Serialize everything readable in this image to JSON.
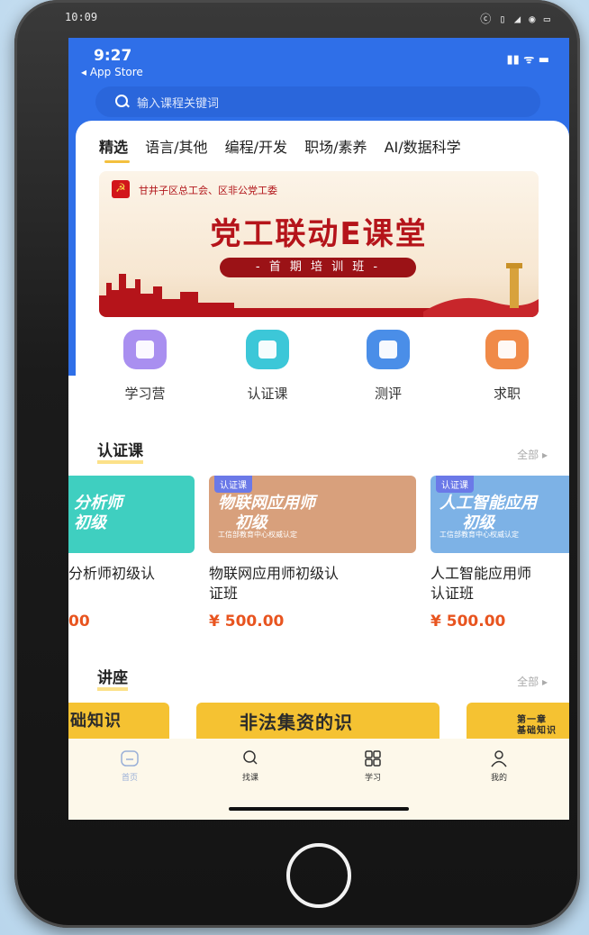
{
  "phone_status": {
    "time": "10:09",
    "icons": "ⓒ ▯ ◢ ◉ ▭"
  },
  "ios_status": {
    "time": "9:27",
    "back": "◂ App Store",
    "icons": "▮▮ ᯤ ▬"
  },
  "search": {
    "placeholder": "输入课程关键词"
  },
  "tabs": [
    "精选",
    "语言/其他",
    "编程/开发",
    "职场/素养",
    "AI/数据科学"
  ],
  "banner": {
    "org": "甘井子区总工会、区非公党工委",
    "title": "党工联动E课堂",
    "subtitle": "- 首 期 培 训 班 -"
  },
  "quick_links": [
    {
      "label": "学习营",
      "icon": "book-icon",
      "color": "#a98ff0"
    },
    {
      "label": "认证课",
      "icon": "tv-icon",
      "color": "#3cc7d8"
    },
    {
      "label": "测评",
      "icon": "clipboard-icon",
      "color": "#4a8ee8"
    },
    {
      "label": "求职",
      "icon": "briefcase-icon",
      "color": "#f08a48"
    }
  ],
  "cert_section": {
    "title": "认证课",
    "more": "全部 ▸"
  },
  "courses": [
    {
      "tag": "",
      "img_text": "分析师\n初级",
      "img_small": "工信部教育中心权威认定",
      "name": "分析师初级认",
      "name2": "",
      "price": "00",
      "color": "#3fcfc0"
    },
    {
      "tag": "认证课",
      "img_text": "物联网应用师\n初级",
      "img_small": "工信部教育中心权威认定",
      "name": "物联网应用师初级认",
      "name2": "证班",
      "price": "¥ 500.00",
      "color": "#d8a07c"
    },
    {
      "tag": "认证课",
      "img_text": "人工智能应用\n初级",
      "img_small": "工信部教育中心权威认定",
      "name": "人工智能应用师",
      "name2": "认证班",
      "price": "¥ 500.00",
      "color": "#7db2e6"
    }
  ],
  "lecture_section": {
    "title": "讲座",
    "more": "全部 ▸"
  },
  "lectures": [
    {
      "text": "础知识"
    },
    {
      "text": "非法集资的识"
    },
    {
      "text": "第一章\n基础知识"
    }
  ],
  "tabbar": [
    {
      "label": "首页",
      "icon": "home-icon"
    },
    {
      "label": "找课",
      "icon": "search-icon"
    },
    {
      "label": "学习",
      "icon": "grid-icon"
    },
    {
      "label": "我的",
      "icon": "user-icon"
    }
  ]
}
